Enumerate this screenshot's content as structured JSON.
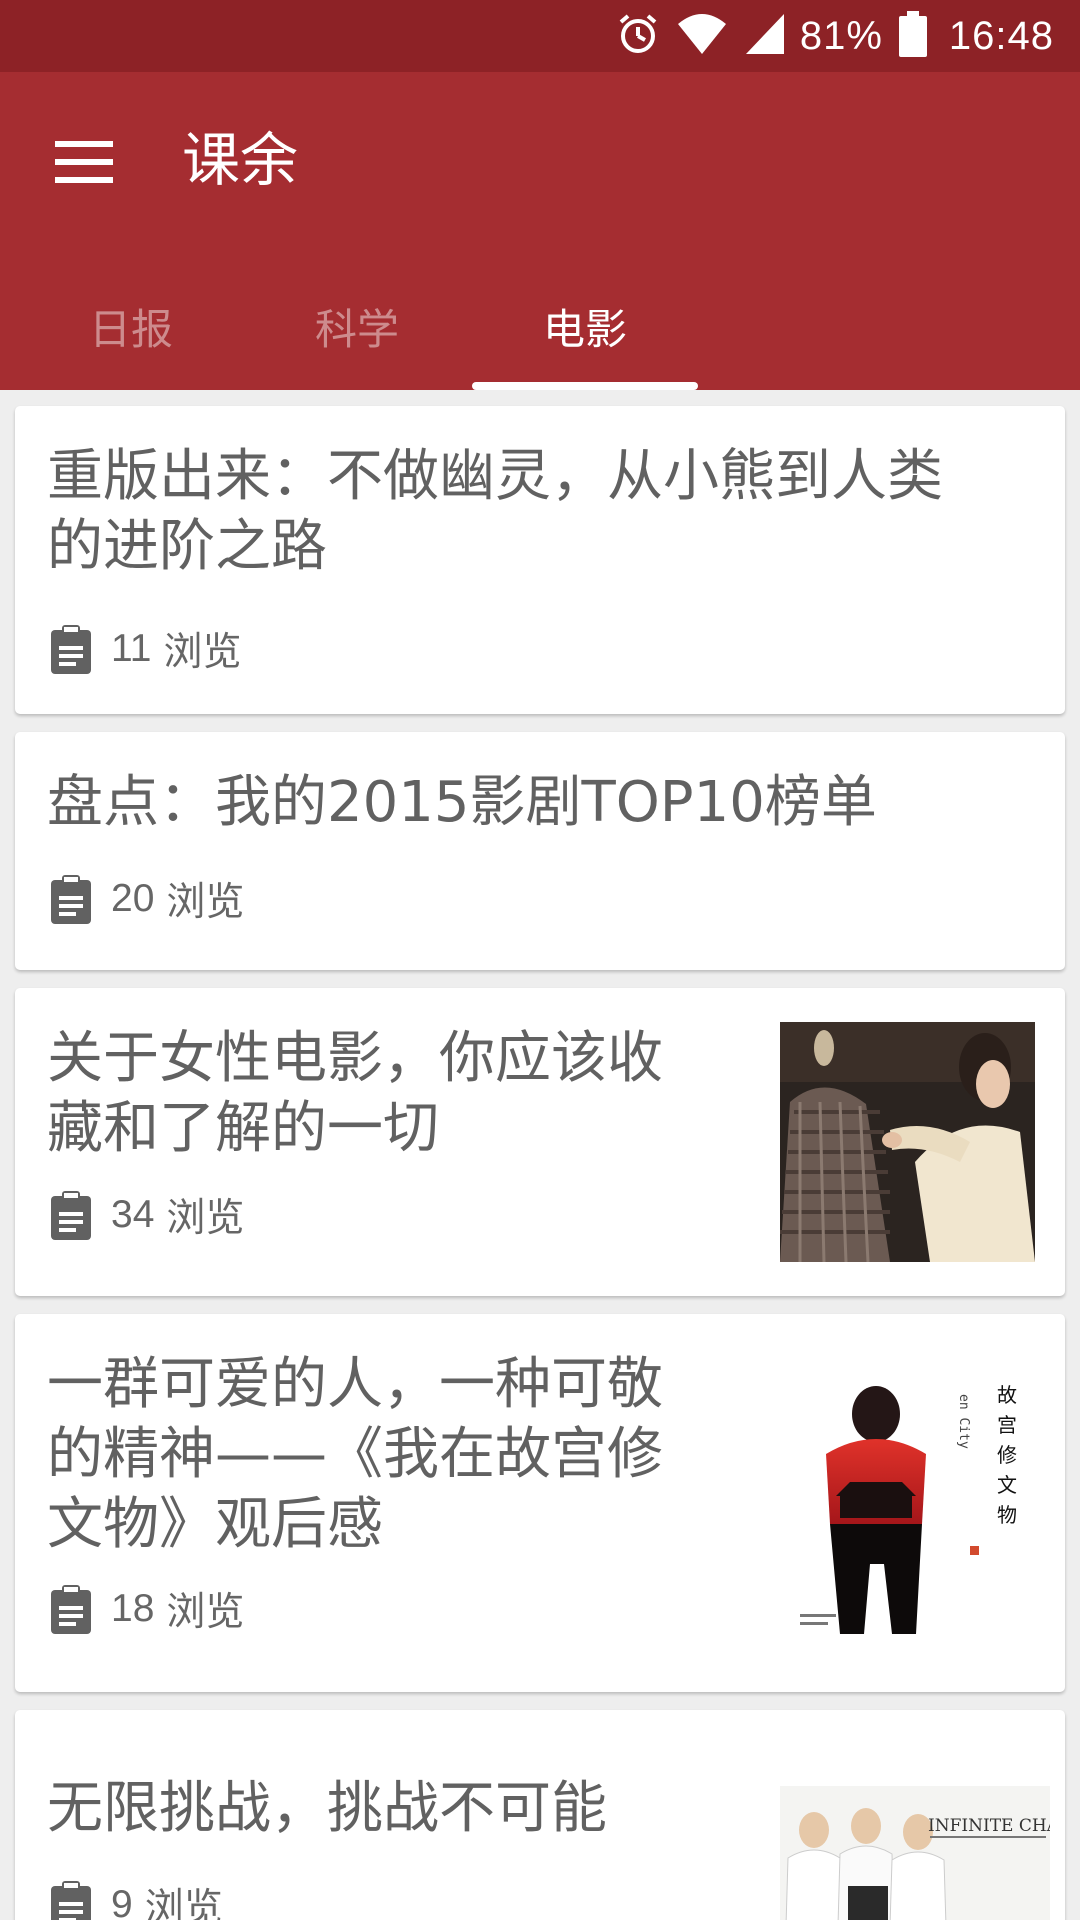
{
  "status_bar": {
    "battery": "81%",
    "time": "16:48",
    "icons": [
      "alarm-icon",
      "wifi-icon",
      "signal-icon",
      "battery-icon"
    ]
  },
  "app": {
    "title": "课余",
    "accent": "#a52d31"
  },
  "tabs": [
    {
      "label": "日报",
      "selected": false
    },
    {
      "label": "科学",
      "selected": false
    },
    {
      "label": "电影",
      "selected": true
    }
  ],
  "views_label": "浏览",
  "articles": [
    {
      "title_lines": [
        "重版出来：不做幽灵，从小熊到人类",
        "的进阶之路"
      ],
      "views": "11"
    },
    {
      "title_lines": [
        "盘点：我的2015影剧TOP10榜单"
      ],
      "views": "20"
    },
    {
      "title_lines": [
        "关于女性电影，你应该收",
        "藏和了解的一切"
      ],
      "views": "34"
    },
    {
      "title_lines": [
        "一群可爱的人，一种可敬",
        "的精神——《我在故宫修",
        "文物》观后感"
      ],
      "views": "18",
      "poster": {
        "title_chars": [
          "故",
          "宫",
          "修",
          "文",
          "物"
        ],
        "vertical_text": "en City"
      }
    },
    {
      "title_lines": [
        "无限挑战，挑战不可能"
      ],
      "views": "9",
      "poster": {
        "logo": "INFINITE CHAL"
      }
    }
  ]
}
